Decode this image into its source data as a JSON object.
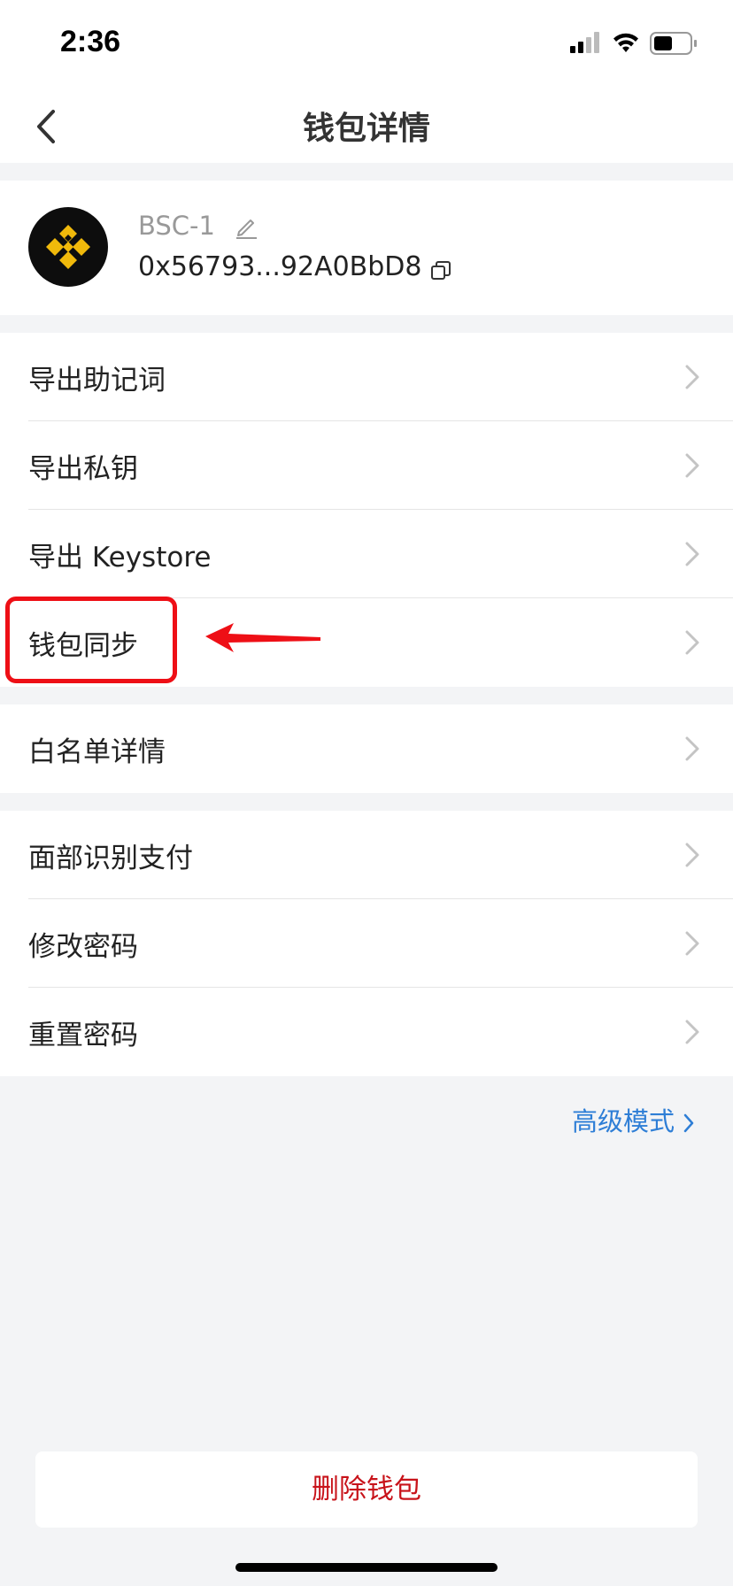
{
  "status": {
    "time": "2:36"
  },
  "header": {
    "title": "钱包详情"
  },
  "wallet": {
    "name": "BSC-1",
    "address": "0x56793...92A0BbD8",
    "brand_color": "#f0b90b"
  },
  "section1": [
    "导出助记词",
    "导出私钥",
    "导出 Keystore",
    "钱包同步"
  ],
  "section2": [
    "白名单详情"
  ],
  "section3": [
    "面部识别支付",
    "修改密码",
    "重置密码"
  ],
  "advanced_mode": "高级模式",
  "delete_label": "删除钱包",
  "accent_color": "#2e7ed6",
  "danger_color": "#c8131a",
  "annotation_color": "#ee0f16"
}
